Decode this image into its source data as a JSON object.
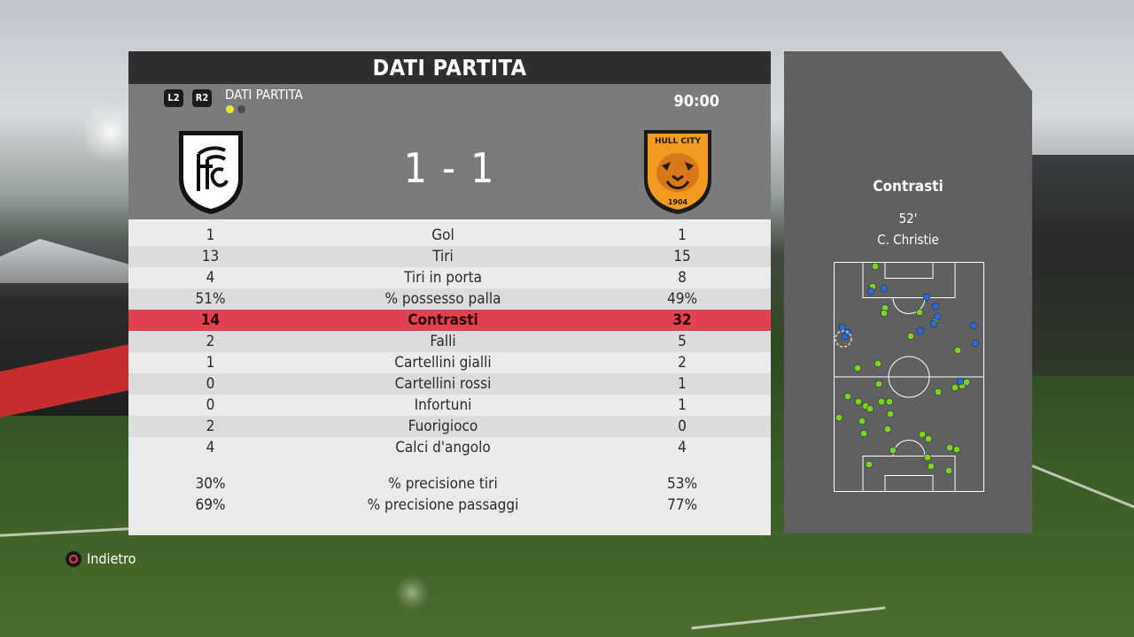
{
  "screen": {
    "panel_title": "DATI PARTITA",
    "nav": {
      "l2": "L2",
      "r2": "R2",
      "section_label": "DATI PARTITA",
      "page_dots": [
        "#e6e62c",
        "#4a4c4e"
      ]
    },
    "match_time": "90:00",
    "score": "1 - 1",
    "home_team": {
      "crest": "fulham-crest-icon"
    },
    "away_team": {
      "crest": "hull-city-crest-icon",
      "crest_text": "HULL CITY",
      "crest_year": "1904"
    }
  },
  "stats": [
    {
      "home": "1",
      "label": "Gol",
      "away": "1",
      "highlight": false
    },
    {
      "home": "13",
      "label": "Tiri",
      "away": "15",
      "highlight": false
    },
    {
      "home": "4",
      "label": "Tiri in porta",
      "away": "8",
      "highlight": false
    },
    {
      "home": "51%",
      "label": "% possesso palla",
      "away": "49%",
      "highlight": false
    },
    {
      "home": "14",
      "label": "Contrasti",
      "away": "32",
      "highlight": true
    },
    {
      "home": "2",
      "label": "Falli",
      "away": "5",
      "highlight": false
    },
    {
      "home": "1",
      "label": "Cartellini gialli",
      "away": "2",
      "highlight": false
    },
    {
      "home": "0",
      "label": "Cartellini rossi",
      "away": "1",
      "highlight": false
    },
    {
      "home": "0",
      "label": "Infortuni",
      "away": "1",
      "highlight": false
    },
    {
      "home": "2",
      "label": "Fuorigioco",
      "away": "0",
      "highlight": false
    },
    {
      "home": "4",
      "label": "Calci d'angolo",
      "away": "4",
      "highlight": false
    }
  ],
  "precision": [
    {
      "home": "30%",
      "label": "% precisione tiri",
      "away": "53%"
    },
    {
      "home": "69%",
      "label": "% precisione passaggi",
      "away": "77%"
    }
  ],
  "side_panel": {
    "title": "Contrasti",
    "minute": "52'",
    "player": "C. Christie",
    "team_colors": {
      "home": "#2f6bd8",
      "away": "#7ed321"
    }
  },
  "footer": {
    "back_label": "Indietro",
    "back_icon": "circle-button-icon"
  }
}
